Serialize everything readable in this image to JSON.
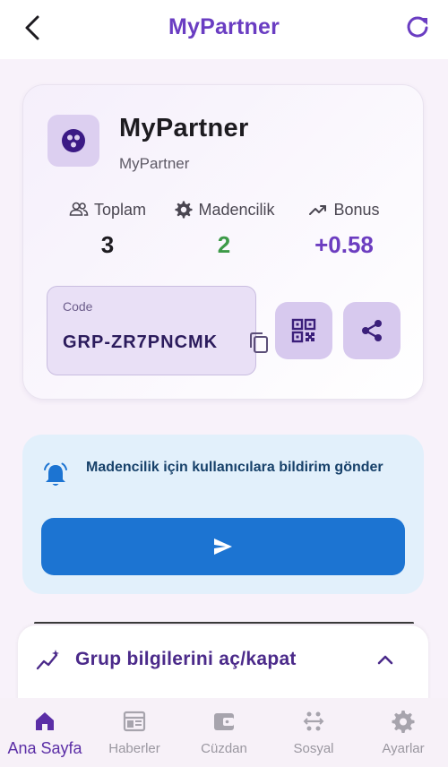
{
  "appbar": {
    "title": "MyPartner",
    "back_icon": "arrow-back-icon",
    "refresh_icon": "refresh-icon"
  },
  "card": {
    "title": "MyPartner",
    "subtitle": "MyPartner",
    "avatar_icon": "group-dots-icon",
    "stats": [
      {
        "label": "Toplam",
        "value": "3",
        "icon": "people-icon",
        "color": "#1d1b20"
      },
      {
        "label": "Madencilik",
        "value": "2",
        "icon": "gear-icon",
        "color": "#3d9a48"
      },
      {
        "label": "Bonus",
        "value": "+0.58",
        "icon": "trending-up-icon",
        "color": "#6c3dc0"
      }
    ],
    "code": {
      "label": "Code",
      "value": "GRP-ZR7PNCMK",
      "copy_icon": "copy-icon"
    },
    "qr_icon": "qr-code-icon",
    "share_icon": "share-icon"
  },
  "notify": {
    "message": "Madencilik için kullanıcılara bildirim gönder",
    "bell_icon": "bell-icon",
    "send_icon": "send-icon"
  },
  "collapse": {
    "title": "Grup bilgilerini aç/kapat",
    "icon": "sparkline-icon",
    "chevron_icon": "chevron-up-icon"
  },
  "nav": {
    "items": [
      {
        "label": "Ana Sayfa",
        "icon": "home-icon",
        "active": true
      },
      {
        "label": "Haberler",
        "icon": "newspaper-icon",
        "active": false
      },
      {
        "label": "Cüzdan",
        "icon": "wallet-icon",
        "active": false
      },
      {
        "label": "Sosyal",
        "icon": "social-icon",
        "active": false
      },
      {
        "label": "Ayarlar",
        "icon": "settings-icon",
        "active": false
      }
    ]
  },
  "colors": {
    "accent": "#6a3dc2",
    "send_button": "#1c74d2",
    "notify_bg": "#e2f0fb"
  }
}
